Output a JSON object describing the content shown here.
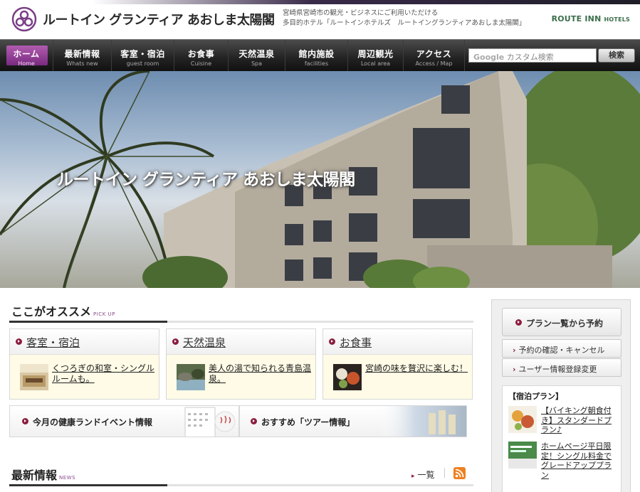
{
  "header": {
    "logo_text": "ルートイン グランティア あおしま太陽閣",
    "tagline_line1": "宮崎県宮崎市の観光・ビジネスにご利用いただける",
    "tagline_line2": "多目的ホテル「ルートインホテルズ　ルートイングランティアあおしま太陽閣」",
    "brand": "ROUTE INN",
    "brand_suffix": "HOTELS"
  },
  "nav": {
    "items": [
      {
        "jp": "ホーム",
        "en": "Home"
      },
      {
        "jp": "最新情報",
        "en": "Whats new"
      },
      {
        "jp": "客室・宿泊",
        "en": "guest room"
      },
      {
        "jp": "お食事",
        "en": "Cuisine"
      },
      {
        "jp": "天然温泉",
        "en": "Spa"
      },
      {
        "jp": "館内施設",
        "en": "facilities"
      },
      {
        "jp": "周辺観光",
        "en": "Local area"
      },
      {
        "jp": "アクセス",
        "en": "Access / Map"
      }
    ],
    "search_google": "Google",
    "search_placeholder": "カスタム検索",
    "search_button": "検索"
  },
  "hero": {
    "title": "ルートイン グランティア あおしま太陽閣"
  },
  "pickup": {
    "title": "ここがオススメ",
    "title_en": "PICK UP",
    "cards": [
      {
        "label": "客室・宿泊",
        "text": "くつろぎの和室・シングルルームも。"
      },
      {
        "label": "天然温泉",
        "text": "美人の湯で知られる青島温泉。"
      },
      {
        "label": "お食事",
        "text": "宮崎の味を贅沢に楽しむ！"
      }
    ],
    "banners": [
      {
        "label": "今月の健康ランドイベント情報"
      },
      {
        "label": "おすすめ「ツアー情報」"
      }
    ]
  },
  "news": {
    "title": "最新情報",
    "title_en": "NEWS",
    "list_link": "一覧"
  },
  "sidebar": {
    "main_button": "プラン一覧から予約",
    "buttons": [
      "予約の確認・キャンセル",
      "ユーザー情報登録変更"
    ],
    "plan_title": "【宿泊プラン】",
    "plans": [
      {
        "text": "【バイキング朝食付き】スタンダードプラン♪"
      },
      {
        "text": "ホームページ平日限定！シングル料金でグレードアッププラン"
      }
    ]
  },
  "colors": {
    "accent_purple": "#7a2a80",
    "bullet_red": "#8b1e3f",
    "brand_green": "#3c6e4a",
    "card_body": "#fffbe6"
  }
}
